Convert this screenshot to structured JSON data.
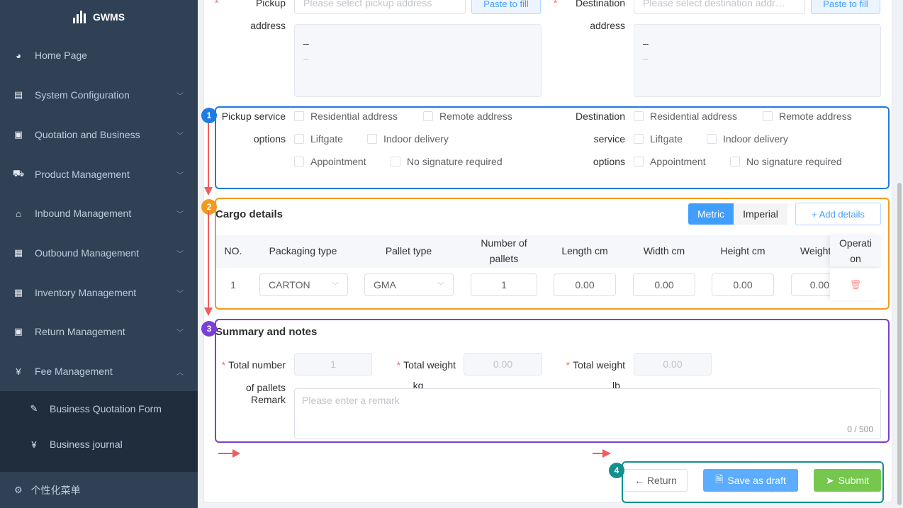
{
  "sidebar": {
    "brand": "GWMS",
    "items": [
      {
        "label": "Home Page",
        "icon": "dashboard-icon"
      },
      {
        "label": "System Configuration",
        "icon": "system-icon"
      },
      {
        "label": "Quotation and Business",
        "icon": "quotation-icon"
      },
      {
        "label": "Product Management",
        "icon": "cart-icon"
      },
      {
        "label": "Inbound Management",
        "icon": "home-icon"
      },
      {
        "label": "Outbound Management",
        "icon": "grid-icon"
      },
      {
        "label": "Inventory Management",
        "icon": "table-icon"
      },
      {
        "label": "Return Management",
        "icon": "return-icon"
      },
      {
        "label": "Fee Management",
        "icon": "yen-icon"
      }
    ],
    "sub_items": [
      {
        "label": "Business Quotation Form",
        "icon": "edit-icon"
      },
      {
        "label": "Business journal",
        "icon": "yen-icon"
      }
    ],
    "custom_menu": "个性化菜单"
  },
  "address": {
    "pickup_label_1": "Pickup",
    "pickup_label_2": "address",
    "pickup_placeholder": "Please select pickup address",
    "dest_label_1": "Destination",
    "dest_label_2": "address",
    "dest_placeholder": "Please select destination addr…",
    "paste_label": "Paste to fill",
    "dash": "–",
    "dash2": "–"
  },
  "services": {
    "pickup_label_1": "Pickup service",
    "pickup_label_2": "options",
    "dest_label_1": "Destination",
    "dest_label_2": "service",
    "dest_label_3": "options",
    "opt_residential": "Residential address",
    "opt_remote": "Remote address",
    "opt_liftgate": "Liftgate",
    "opt_indoor": "Indoor delivery",
    "opt_appointment": "Appointment",
    "opt_nosig": "No signature required"
  },
  "cargo": {
    "title": "Cargo details",
    "unit_metric": "Metric",
    "unit_imperial": "Imperial",
    "add_details": "+ Add details",
    "columns": {
      "no": "NO.",
      "packaging": "Packaging type",
      "pallet": "Pallet type",
      "num_pallets_1": "Number of",
      "num_pallets_2": "pallets",
      "length": "Length cm",
      "width": "Width cm",
      "height": "Height cm",
      "weight": "Weight",
      "operation_1": "Operati",
      "operation_2": "on"
    },
    "rows": [
      {
        "no": "1",
        "packaging": "CARTON",
        "pallet": "GMA",
        "pallets": "1",
        "length": "0.00",
        "width": "0.00",
        "height": "0.00",
        "weight": "0.00"
      }
    ]
  },
  "summary": {
    "title": "Summary and notes",
    "total_pallets_1": "Total number",
    "total_pallets_2": "of pallets",
    "total_pallets_value": "1",
    "total_weight_kg_1": "Total weight",
    "total_weight_kg_2": "kg",
    "total_weight_kg_value": "0.00",
    "total_weight_lb_1": "Total weight",
    "total_weight_lb_2": "lb",
    "total_weight_lb_value": "0.00",
    "remark_label": "Remark",
    "remark_placeholder": "Please enter a remark",
    "remark_count": "0 / 500"
  },
  "actions": {
    "return": "← Return",
    "save_draft": "Save as draft",
    "submit": "Submit"
  },
  "annotations": {
    "n1": "1",
    "n2": "2",
    "n3": "3",
    "n4": "4",
    "colors": {
      "blue": "#1e7be0",
      "orange": "#f39a1e",
      "purple": "#7b3fd6",
      "teal": "#138f8f",
      "arrow": "#f25c5c"
    }
  }
}
